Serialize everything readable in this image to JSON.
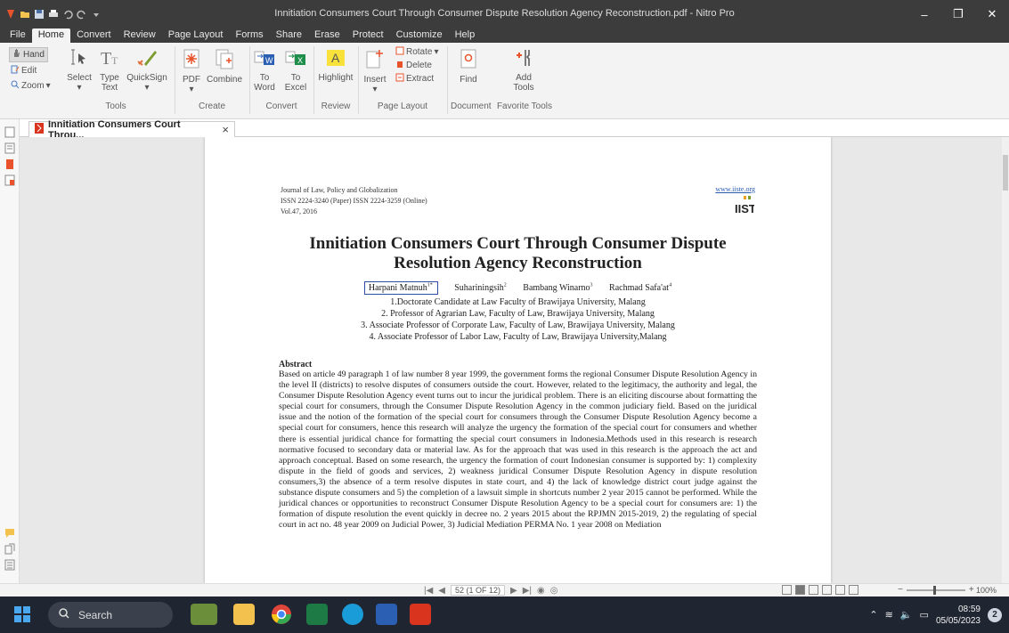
{
  "window": {
    "title": "Innitiation Consumers Court Through Consumer Dispute Resolution Agency Reconstruction.pdf - Nitro Pro",
    "controls": [
      "‒",
      "❐",
      "✕"
    ]
  },
  "menu": {
    "tabs": [
      "File",
      "Home",
      "Convert",
      "Review",
      "Page Layout",
      "Forms",
      "Share",
      "Erase",
      "Protect",
      "Customize",
      "Help"
    ],
    "active": "Home"
  },
  "ribbon": {
    "hand": "Hand",
    "edit": "Edit",
    "zoom": "Zoom",
    "select": "Select",
    "type_text_1": "Type",
    "type_text_2": "Text",
    "quicksign": "QuickSign",
    "pdf": "PDF",
    "combine": "Combine",
    "to_word_1": "To",
    "to_word_2": "Word",
    "to_excel_1": "To",
    "to_excel_2": "Excel",
    "highlight": "Highlight",
    "insert": "Insert",
    "rotate": "Rotate",
    "delete": "Delete",
    "extract": "Extract",
    "find": "Find",
    "add_tools_1": "Add",
    "add_tools_2": "Tools",
    "groups": {
      "tools": "Tools",
      "create": "Create",
      "convert": "Convert",
      "review": "Review",
      "page_layout": "Page Layout",
      "document": "Document",
      "favorite_tools": "Favorite Tools"
    }
  },
  "doc_tab": {
    "label": "Innitiation Consumers Court Throu...",
    "close": "×"
  },
  "page": {
    "journal": "Journal of Law, Policy and Globalization",
    "issn": "ISSN 2224-3240 (Paper) ISSN 2224-3259 (Online)",
    "vol": "Vol.47, 2016",
    "url": "www.iiste.org",
    "title_line1": "Innitiation Consumers Court Through Consumer Dispute",
    "title_line2": "Resolution Agency Reconstruction",
    "authors": [
      "Harpani Matnuh",
      "Suhariningsih",
      "Bambang Winarno",
      "Rachmad Safa'at"
    ],
    "author_marks": [
      "1*",
      "2",
      "3",
      "4"
    ],
    "affiliations": [
      "1.Doctorate Candidate at Law Faculty of Brawijaya University, Malang",
      "2. Professor of Agrarian Law, Faculty of Law, Brawijaya University, Malang",
      "3. Associate Professor of Corporate Law, Faculty of Law, Brawijaya University, Malang",
      "4. Associate Professor of Labor Law, Faculty of Law, Brawijaya University,Malang"
    ],
    "abstract_heading": "Abstract",
    "abstract_text": "Based on article 49 paragraph 1 of law number 8 year 1999, the government forms the regional Consumer Dispute Resolution Agency in the level II (districts) to resolve disputes of consumers outside the court. However, related to the legitimacy, the authority and legal, the Consumer Dispute Resolution Agency event turns out to incur the juridical problem. There is an eliciting discourse about formatting the special court for consumers, through the Consumer Dispute Resolution Agency in the common judiciary field. Based on the juridical issue and the notion of the formation of the special court for consumers through the Consumer Dispute Resolution Agency become a special court for consumers, hence this research will analyze the urgency the formation of the special court for consumers and whether there is essential juridical chance for formatting the special court consumers in Indonesia.Methods used in this research is research normative focused to secondary data or material law. As for the approach that was used in this research is the approach the act and approach conceptual. Based on some research, the urgency the formation of court Indonesian consumer is supported by: 1) complexity dispute in the field of goods and services, 2) weakness juridical Consumer Dispute Resolution Agency in dispute resolution consumers,3) the absence of a term resolve disputes in state court, and 4) the lack of knowledge district court judge against the substance dispute consumers and 5) the completion of a lawsuit simple in shortcuts number 2 year 2015 cannot be performed. While the juridical chances or opportunities to reconstruct Consumer Dispute Resolution Agency to be a special court for consumers are: 1) the formation of dispute resolution the event quickly in decree no. 2 years 2015 about the RPJMN 2015-2019, 2) the regulating of special court in act no. 48 year 2009 on Judicial Power, 3) Judicial Mediation PERMA No. 1 year 2008 on Mediation"
  },
  "status": {
    "page_indicator": "52 (1 OF 12)",
    "zoom": "100%",
    "zoom_level_pct": 100
  },
  "taskbar": {
    "search": "Search",
    "time": "08:59",
    "date": "05/05/2023",
    "notifications": "2"
  },
  "colors": {
    "titlebar": "#3c3c3c",
    "ribbon": "#f3f3f3",
    "author_box": "#2e4fa2",
    "taskbar": "#1f2531",
    "nitro_red": "#d9341e"
  }
}
